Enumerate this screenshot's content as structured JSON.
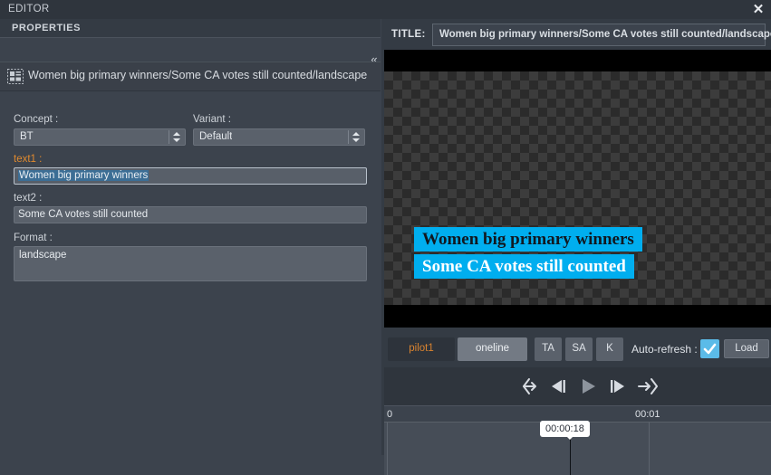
{
  "window": {
    "title": "EDITOR",
    "close_icon": "close-icon"
  },
  "left_panel": {
    "section_title": "PROPERTIES",
    "collapse_icon": "chevron-double-left-icon",
    "document": {
      "icon": "template-layout-icon",
      "name": "Women big primary winners/Some CA votes still counted/landscape"
    },
    "fields": {
      "concept": {
        "label": "Concept :",
        "value": "BT"
      },
      "variant": {
        "label": "Variant :",
        "value": "Default"
      },
      "text1": {
        "label": "text1 :",
        "value": "Women big primary winners"
      },
      "text2": {
        "label": "text2 :",
        "value": "Some CA votes still counted"
      },
      "format": {
        "label": "Format :",
        "value": "landscape"
      }
    }
  },
  "right_panel": {
    "title_label": "TITLE:",
    "title_value": "Women big primary winners/Some CA votes still counted/landscape",
    "preview": {
      "line1": "Women big primary winners",
      "line2": "Some CA votes still counted",
      "accent_color": "#00aeef",
      "line1_text_color": "#111820",
      "line2_text_color": "#ffffff"
    },
    "toolbar": {
      "tabs": [
        {
          "label": "pilot1",
          "active": false
        },
        {
          "label": "oneline",
          "active": true
        }
      ],
      "buttons": [
        {
          "label": "TA"
        },
        {
          "label": "SA"
        },
        {
          "label": "K"
        }
      ],
      "auto_refresh_label": "Auto-refresh :",
      "auto_refresh_checked": true,
      "load_label": "Load"
    },
    "transport": [
      {
        "name": "go-to-start-icon"
      },
      {
        "name": "step-backward-icon"
      },
      {
        "name": "play-icon"
      },
      {
        "name": "step-forward-icon"
      },
      {
        "name": "go-to-end-icon"
      }
    ],
    "timeline": {
      "ticks": [
        "0",
        "00:01"
      ],
      "playhead_time": "00:00:18"
    }
  }
}
